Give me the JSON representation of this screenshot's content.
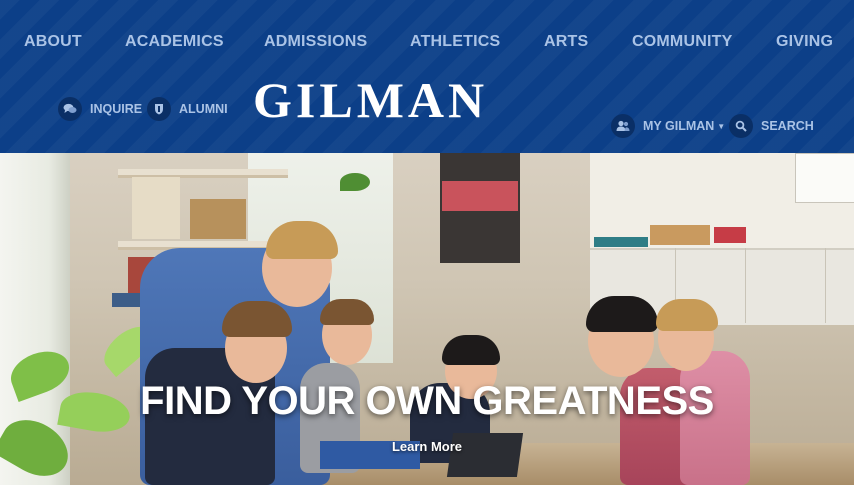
{
  "nav": {
    "items": [
      {
        "label": "ABOUT"
      },
      {
        "label": "ACADEMICS"
      },
      {
        "label": "ADMISSIONS"
      },
      {
        "label": "ATHLETICS"
      },
      {
        "label": "ARTS"
      },
      {
        "label": "COMMUNITY"
      },
      {
        "label": "GIVING"
      }
    ]
  },
  "utility": {
    "inquire": "INQUIRE",
    "alumni": "ALUMNI",
    "my_gilman": "MY GILMAN",
    "search": "SEARCH"
  },
  "logo": {
    "text": "GILMAN"
  },
  "hero": {
    "headline": "FIND YOUR OWN GREATNESS",
    "cta": "Learn More"
  },
  "colors": {
    "header_blue": "#0c3f88",
    "nav_text": "#aac3e6",
    "icon_circle": "#0a2f66",
    "white": "#ffffff"
  },
  "icons": {
    "inquire": "chat-bubbles-icon",
    "alumni": "shield-icon",
    "my_gilman": "users-icon",
    "search": "search-icon"
  }
}
